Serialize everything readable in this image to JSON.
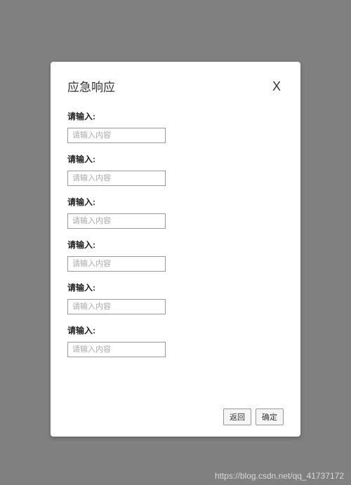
{
  "modal": {
    "title": "应急响应",
    "close_label": "X",
    "fields": [
      {
        "label": "请输入:",
        "placeholder": "请输入内容",
        "value": ""
      },
      {
        "label": "请输入:",
        "placeholder": "请输入内容",
        "value": ""
      },
      {
        "label": "请输入:",
        "placeholder": "请输入内容",
        "value": ""
      },
      {
        "label": "请输入:",
        "placeholder": "请输入内容",
        "value": ""
      },
      {
        "label": "请输入:",
        "placeholder": "请输入内容",
        "value": ""
      },
      {
        "label": "请输入:",
        "placeholder": "请输入内容",
        "value": ""
      }
    ],
    "footer": {
      "back_label": "返回",
      "confirm_label": "确定"
    }
  },
  "watermark": "https://blog.csdn.net/qq_41737172"
}
